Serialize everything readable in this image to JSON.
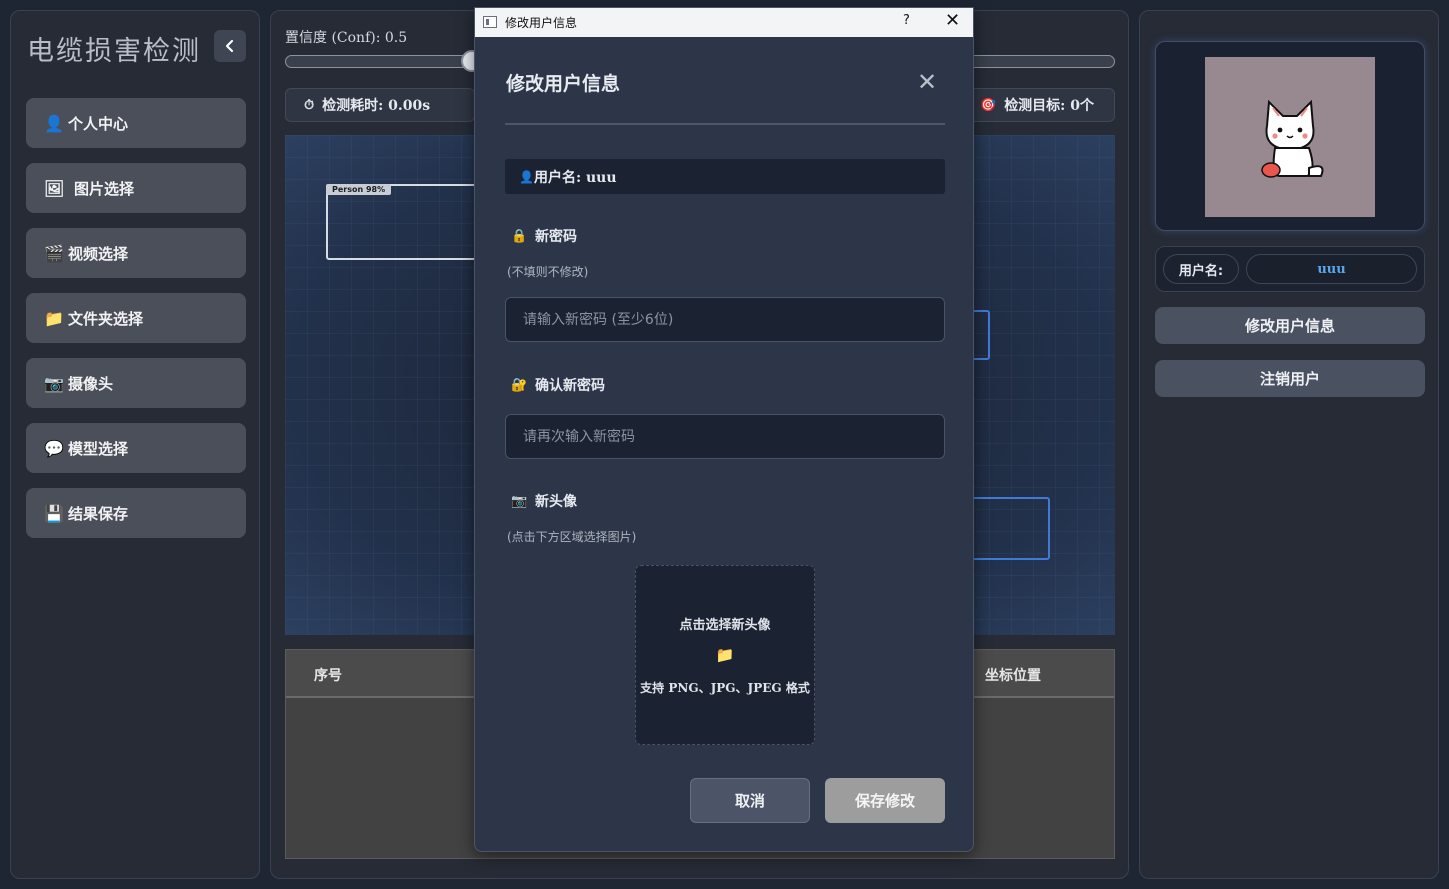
{
  "app": {
    "title": "电缆损害检测"
  },
  "nav": {
    "items": [
      {
        "icon": "👤",
        "label": "个人中心"
      },
      {
        "icon": "🖼",
        "label": "图片选择"
      },
      {
        "icon": "🎬",
        "label": "视频选择"
      },
      {
        "icon": "📁",
        "label": "文件夹选择"
      },
      {
        "icon": "📷",
        "label": "摄像头"
      },
      {
        "icon": "💬",
        "label": "模型选择"
      },
      {
        "icon": "💾",
        "label": "结果保存"
      }
    ]
  },
  "controls": {
    "conf_label": "置信度 (Conf): 0.5",
    "time_icon": "⏱",
    "time_label": "检测耗时: 0.00s",
    "target_icon": "🎯",
    "target_label": "检测目标: 0个"
  },
  "canvas": {
    "detection_tag": "Person 98%"
  },
  "table": {
    "columns": [
      "序号",
      "坐标位置"
    ]
  },
  "profile": {
    "username_label": "用户名:",
    "username_value": "uuu",
    "edit_button": "修改用户信息",
    "logout_button": "注销用户"
  },
  "dialog": {
    "window_title": "修改用户信息",
    "help": "?",
    "close": "✕",
    "heading": "修改用户信息",
    "close_x": "✕",
    "user_icon": "👤",
    "user_text": "用户名: uuu",
    "new_password": {
      "icon": "🔒",
      "label": "新密码",
      "hint": "(不填则不修改)",
      "placeholder": "请输入新密码 (至少6位)"
    },
    "confirm_password": {
      "icon": "🔐",
      "label": "确认新密码",
      "placeholder": "请再次输入新密码"
    },
    "avatar": {
      "icon": "📷",
      "label": "新头像",
      "hint": "(点击下方区域选择图片)",
      "upload_title": "点击选择新头像",
      "upload_icon": "📁",
      "upload_sub": "支持 PNG、JPG、JPEG 格式"
    },
    "cancel_label": "取消",
    "save_label": "保存修改"
  }
}
